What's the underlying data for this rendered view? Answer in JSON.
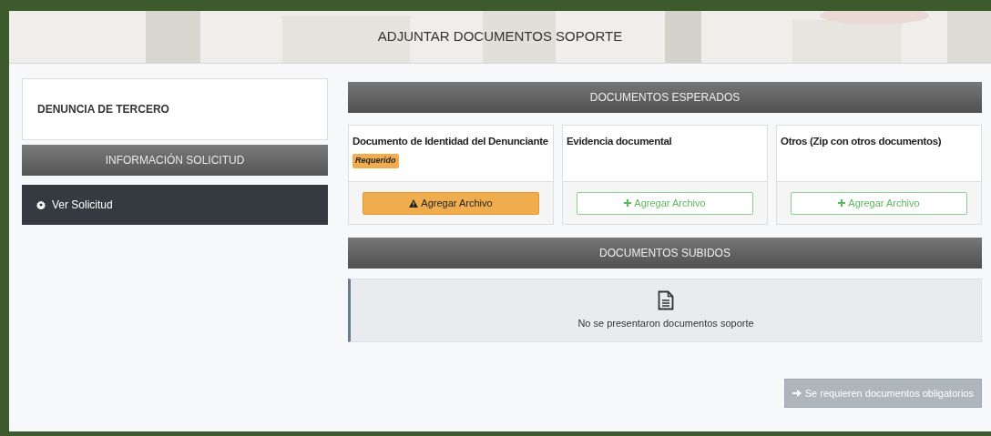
{
  "header": {
    "title": "ADJUNTAR DOCUMENTOS SOPORTE"
  },
  "sidebar": {
    "request_type": "DENUNCIA DE TERCERO",
    "section_title": "INFORMACIÓN SOLICITUD",
    "items": [
      {
        "label": "Ver Solicitud"
      }
    ]
  },
  "expected": {
    "title": "DOCUMENTOS ESPERADOS",
    "documents": [
      {
        "name": "Documento de Identidad del Denunciante",
        "required": true,
        "badge": "Requerido",
        "button": "Agregar Archivo"
      },
      {
        "name": "Evidencia documental",
        "required": false,
        "button": "Agregar Archivo"
      },
      {
        "name": "Otros (Zip con otros documentos)",
        "required": false,
        "button": "Agregar Archivo"
      }
    ]
  },
  "uploaded": {
    "title": "DOCUMENTOS SUBIDOS",
    "empty_message": "No se presentaron documentos soporte"
  },
  "submit": {
    "label": "Se requieren documentos obligatorios",
    "disabled": true
  }
}
